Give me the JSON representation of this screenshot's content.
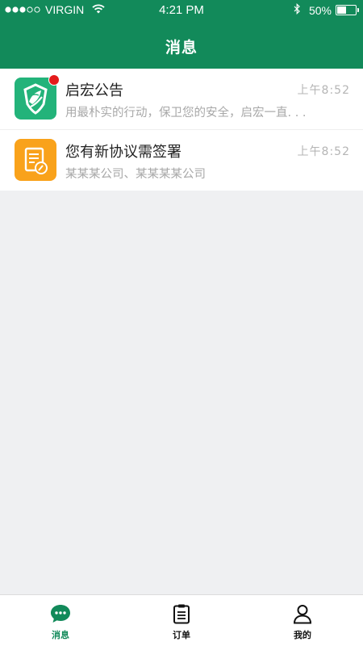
{
  "status_bar": {
    "carrier": "VIRGIN",
    "time": "4:21 PM",
    "battery": "50%",
    "battery_level": 0.5
  },
  "header": {
    "title": "消息"
  },
  "messages": [
    {
      "title": "启宏公告",
      "time": "上午8:52",
      "preview": "用最朴实的行动，保卫您的安全，启宏一直. . .",
      "icon": "qihong-logo-icon",
      "icon_color": "#23b37a",
      "unread": true
    },
    {
      "title": "您有新协议需签署",
      "time": "上午8:52",
      "preview": "某某某公司、某某某某公司",
      "icon": "contract-sign-icon",
      "icon_color": "#f9a21b",
      "unread": false
    }
  ],
  "tabbar": {
    "tabs": [
      {
        "label": "消息",
        "icon": "chat-bubble-icon",
        "active": true
      },
      {
        "label": "订单",
        "icon": "clipboard-list-icon",
        "active": false
      },
      {
        "label": "我的",
        "icon": "person-icon",
        "active": false
      }
    ]
  },
  "colors": {
    "brand": "#128a5a",
    "badge": "#e41b1b",
    "background": "#eff0f2"
  }
}
